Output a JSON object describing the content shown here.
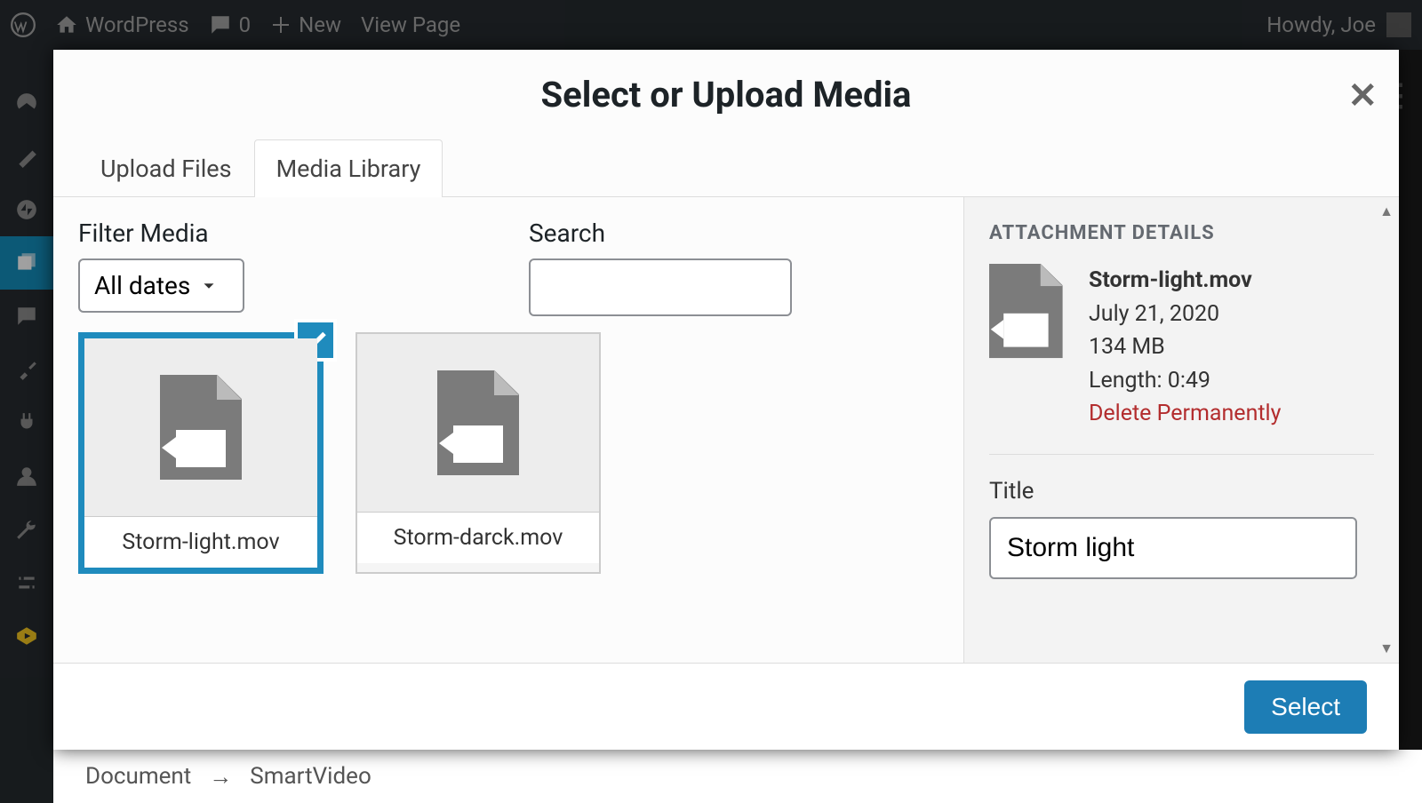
{
  "adminbar": {
    "site_name": "WordPress",
    "comment_count": "0",
    "new_label": "New",
    "view_page": "View Page",
    "greeting": "Howdy, Joe"
  },
  "modal": {
    "title": "Select or Upload Media",
    "tabs": {
      "upload": "Upload Files",
      "library": "Media Library"
    },
    "filter_label": "Filter Media",
    "date_filter": "All dates",
    "search_label": "Search",
    "search_value": "",
    "items": [
      {
        "filename": "Storm-light.mov",
        "selected": true
      },
      {
        "filename": "Storm-darck.mov",
        "selected": false
      }
    ],
    "details": {
      "heading": "ATTACHMENT DETAILS",
      "name": "Storm-light.mov",
      "date": "July 21, 2020",
      "size": "134 MB",
      "length": "Length: 0:49",
      "delete": "Delete Permanently",
      "title_label": "Title",
      "title_value": "Storm light"
    },
    "select_button": "Select"
  },
  "breadcrumb": {
    "doc": "Document",
    "arrow": "→",
    "page": "SmartVideo"
  }
}
